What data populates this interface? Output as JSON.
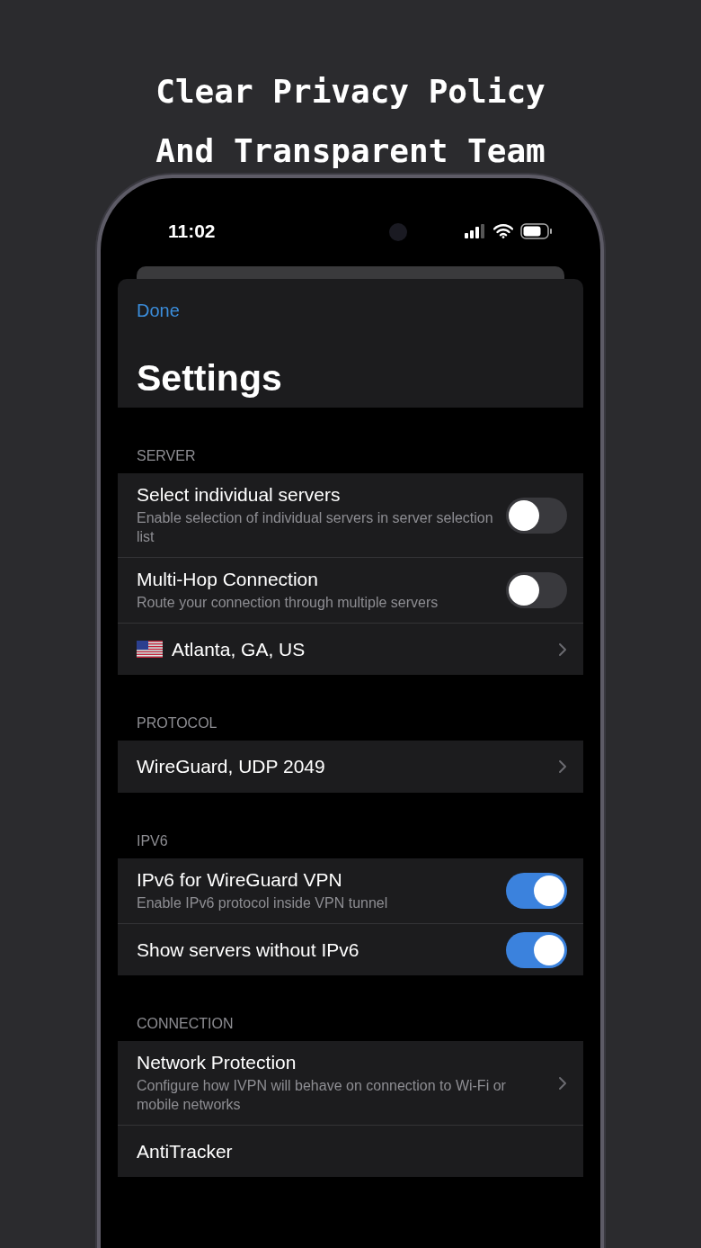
{
  "headline": [
    "Clear Privacy Policy",
    "And Transparent Team"
  ],
  "status_bar": {
    "time": "11:02"
  },
  "nav": {
    "done": "Done",
    "title": "Settings"
  },
  "sections": [
    {
      "header": "SERVER",
      "rows": [
        {
          "kind": "toggle",
          "title": "Select individual servers",
          "subtitle": "Enable selection of individual servers in server selection list",
          "on": false
        },
        {
          "kind": "toggle",
          "title": "Multi-Hop Connection",
          "subtitle": "Route your connection through multiple servers",
          "on": false
        },
        {
          "kind": "location",
          "title": "Atlanta, GA, US"
        }
      ]
    },
    {
      "header": "PROTOCOL",
      "rows": [
        {
          "kind": "link",
          "title": "WireGuard, UDP 2049"
        }
      ]
    },
    {
      "header": "IPV6",
      "rows": [
        {
          "kind": "toggle",
          "title": "IPv6 for WireGuard VPN",
          "subtitle": "Enable IPv6 protocol inside VPN tunnel",
          "on": true
        },
        {
          "kind": "toggle",
          "title": "Show servers without IPv6",
          "on": true
        }
      ]
    },
    {
      "header": "CONNECTION",
      "rows": [
        {
          "kind": "link",
          "title": "Network Protection",
          "subtitle": "Configure how IVPN will behave on connection to Wi-Fi or mobile networks"
        },
        {
          "kind": "text",
          "title": "AntiTracker"
        }
      ]
    }
  ]
}
